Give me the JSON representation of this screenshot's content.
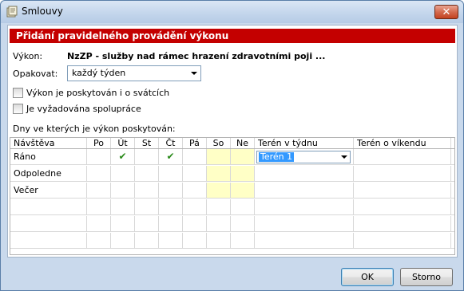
{
  "window": {
    "title": "Smlouvy"
  },
  "header": {
    "title": "Přidání pravidelného provádění výkonu"
  },
  "form": {
    "vykon_label": "Výkon:",
    "vykon_value": "NzZP - služby nad rámec hrazení zdravotními poji ...",
    "opakovat_label": "Opakovat:",
    "opakovat_value": "každý týden",
    "checkbox_svatky": {
      "label": "Výkon je poskytován i o svátcích",
      "checked": false
    },
    "checkbox_spoluprace": {
      "label": "Je vyžadována spolupráce",
      "checked": false
    },
    "dny_label": "Dny ve kterých je výkon poskytován:"
  },
  "grid": {
    "columns": [
      "Návštěva",
      "Po",
      "Út",
      "St",
      "Čt",
      "Pá",
      "So",
      "Ne",
      "Terén v týdnu",
      "Terén o víkendu"
    ],
    "rows": [
      {
        "name": "Ráno",
        "days": [
          "",
          "✔",
          "",
          "✔",
          "",
          "",
          ""
        ],
        "teren_tyden": "Terén 1",
        "teren_vikend": ""
      },
      {
        "name": "Odpoledne",
        "days": [
          "",
          "",
          "",
          "",
          "",
          "",
          ""
        ],
        "teren_tyden": "",
        "teren_vikend": ""
      },
      {
        "name": "Večer",
        "days": [
          "",
          "",
          "",
          "",
          "",
          "",
          ""
        ],
        "teren_tyden": "",
        "teren_vikend": ""
      }
    ]
  },
  "buttons": {
    "ok": "OK",
    "cancel": "Storno"
  },
  "colors": {
    "header_red": "#c40000",
    "weekend_yellow": "#ffffc6",
    "check_green": "#2a8a1a"
  }
}
